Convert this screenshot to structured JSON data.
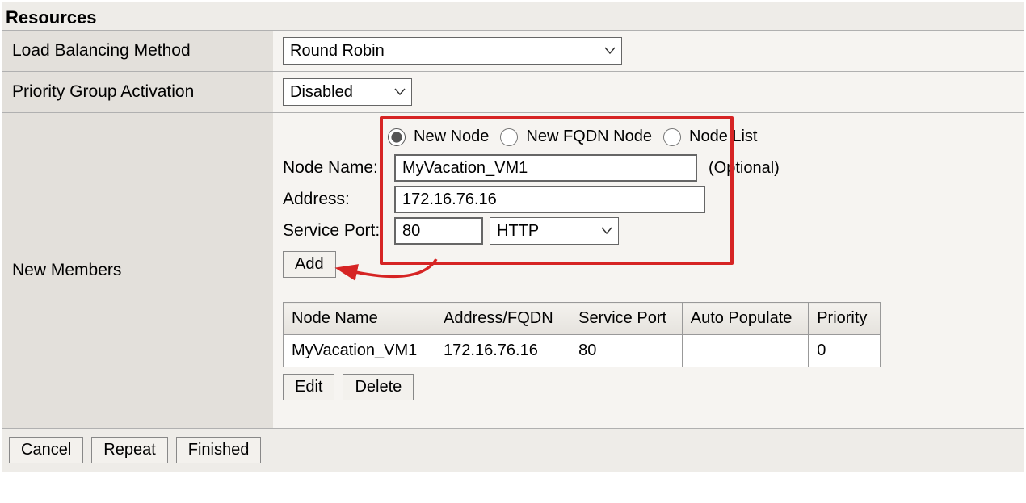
{
  "panel": {
    "title": "Resources"
  },
  "rows": {
    "lb_method": {
      "label": "Load Balancing Method",
      "value": "Round Robin"
    },
    "pga": {
      "label": "Priority Group Activation",
      "value": "Disabled"
    },
    "new_members": {
      "label": "New Members"
    }
  },
  "node_type": {
    "options": {
      "new_node": "New Node",
      "new_fqdn": "New FQDN Node",
      "node_list": "Node List"
    },
    "selected": "new_node"
  },
  "node_name": {
    "label": "Node Name:",
    "value": "MyVacation_VM1",
    "optional_text": "(Optional)"
  },
  "address": {
    "label": "Address:",
    "value": "172.16.76.16"
  },
  "service_port": {
    "label": "Service Port:",
    "value": "80",
    "protocol": "HTTP"
  },
  "buttons": {
    "add": "Add",
    "edit": "Edit",
    "delete": "Delete",
    "cancel": "Cancel",
    "repeat": "Repeat",
    "finished": "Finished"
  },
  "table": {
    "headers": {
      "node_name": "Node Name",
      "address": "Address/FQDN",
      "service_port": "Service Port",
      "auto_populate": "Auto Populate",
      "priority": "Priority"
    },
    "rows": [
      {
        "node_name": "MyVacation_VM1",
        "address": "172.16.76.16",
        "service_port": "80",
        "auto_populate": "",
        "priority": "0"
      }
    ]
  }
}
